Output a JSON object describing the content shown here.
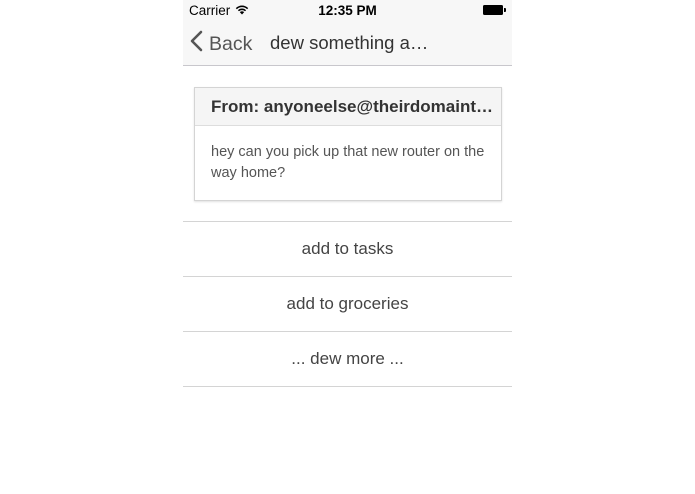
{
  "status_bar": {
    "carrier": "Carrier",
    "time": "12:35 PM"
  },
  "nav": {
    "back_label": "Back",
    "title": "dew something a…"
  },
  "email": {
    "from": "From: anyoneelse@theirdomaint…",
    "body": "hey can you pick up that new router on the way home?"
  },
  "actions": [
    {
      "label": "add to tasks"
    },
    {
      "label": "add to groceries"
    },
    {
      "label": "... dew more ..."
    }
  ]
}
